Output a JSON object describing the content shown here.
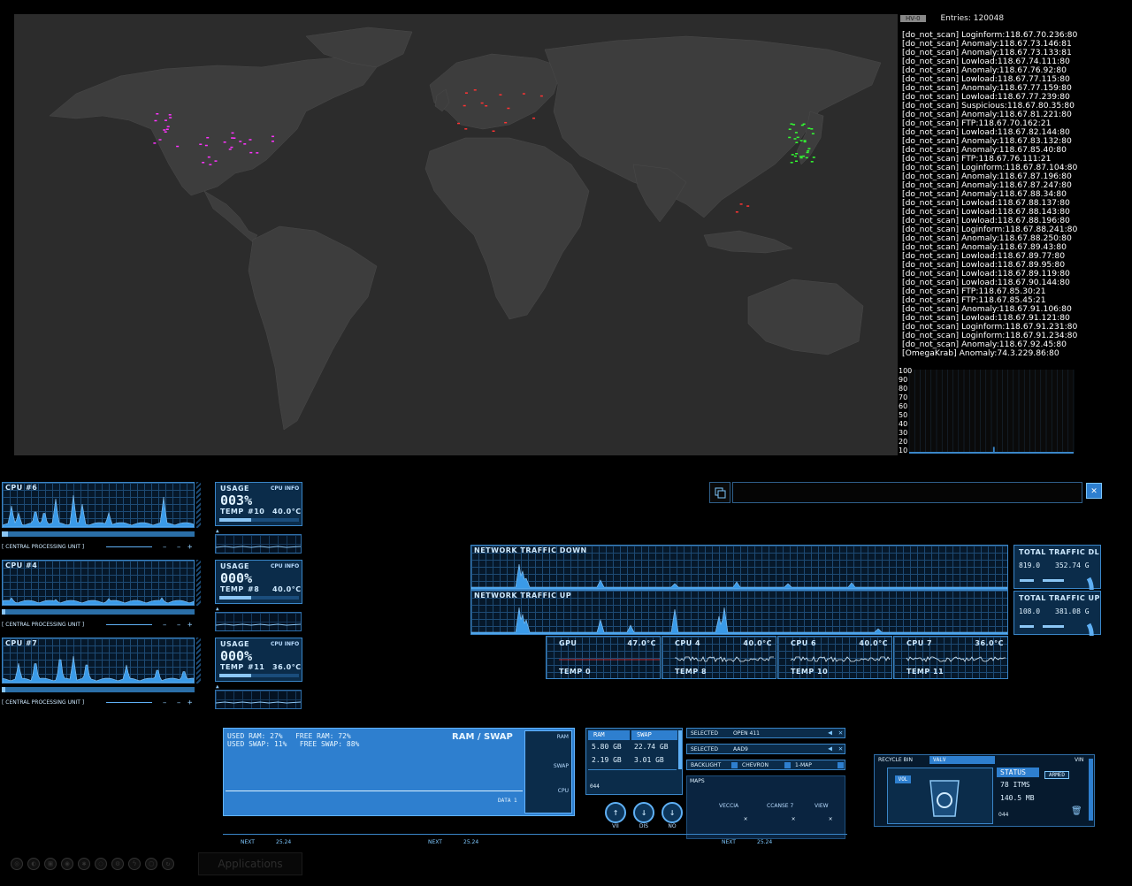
{
  "log": {
    "badge": "HV-0",
    "entries_label": "Entries: 120048",
    "lines": [
      "[do_not_scan] Loginform:118.67.70.236:80",
      "[do_not_scan] Anomaly:118.67.73.146:81",
      "[do_not_scan] Anomaly:118.67.73.133:81",
      "[do_not_scan] Lowload:118.67.74.111:80",
      "[do_not_scan] Anomaly:118.67.76.92:80",
      "[do_not_scan] Lowload:118.67.77.115:80",
      "[do_not_scan] Anomaly:118.67.77.159:80",
      "[do_not_scan] Lowload:118.67.77.239:80",
      "[do_not_scan] Suspicious:118.67.80.35:80",
      "[do_not_scan] Anomaly:118.67.81.221:80",
      "[do_not_scan] FTP:118.67.70.162:21",
      "[do_not_scan] Lowload:118.67.82.144:80",
      "[do_not_scan] Anomaly:118.67.83.132:80",
      "[do_not_scan] Anomaly:118.67.85.40:80",
      "[do_not_scan] FTP:118.67.76.111:21",
      "[do_not_scan] Loginform:118.67.87.104:80",
      "[do_not_scan] Anomaly:118.67.87.196:80",
      "[do_not_scan] Anomaly:118.67.87.247:80",
      "[do_not_scan] Anomaly:118.67.88.34:80",
      "[do_not_scan] Lowload:118.67.88.137:80",
      "[do_not_scan] Lowload:118.67.88.143:80",
      "[do_not_scan] Lowload:118.67.88.196:80",
      "[do_not_scan] Loginform:118.67.88.241:80",
      "[do_not_scan] Anomaly:118.67.88.250:80",
      "[do_not_scan] Anomaly:118.67.89.43:80",
      "[do_not_scan] Lowload:118.67.89.77:80",
      "[do_not_scan] Lowload:118.67.89.95:80",
      "[do_not_scan] Lowload:118.67.89.119:80",
      "[do_not_scan] Lowload:118.67.90.144:80",
      "[do_not_scan] FTP:118.67.85.30:21",
      "[do_not_scan] FTP:118.67.85.45:21",
      "[do_not_scan] Anomaly:118.67.91.106:80",
      "[do_not_scan] Lowload:118.67.91.121:80",
      "[do_not_scan] Loginform:118.67.91.231:80",
      "[do_not_scan] Loginform:118.67.91.234:80",
      "[do_not_scan] Anomaly:118.67.92.45:80",
      "[OmegaKrab] Anomaly:74.3.229.86:80"
    ]
  },
  "histogram": {
    "ticks": [
      "100",
      "90",
      "80",
      "70",
      "60",
      "50",
      "40",
      "30",
      "20",
      "10"
    ],
    "values": [
      0,
      0,
      0,
      0,
      0,
      0,
      0,
      0,
      0,
      0,
      0,
      0,
      0,
      0,
      0,
      0,
      0,
      0,
      0,
      0,
      0,
      0,
      0,
      0,
      0,
      0,
      0,
      0,
      0,
      0,
      0,
      0,
      0,
      0,
      0,
      0,
      0,
      0,
      0,
      0,
      0,
      0,
      0,
      0,
      0,
      0,
      0,
      0,
      0,
      0,
      0,
      7,
      0,
      0,
      0,
      0,
      0,
      0,
      0,
      0,
      0,
      0,
      0,
      0,
      0,
      0,
      0,
      0,
      0,
      0,
      0,
      0,
      0,
      0,
      0,
      0,
      0,
      0,
      0,
      0,
      0,
      0,
      0,
      0,
      0,
      0,
      0,
      0,
      0,
      0,
      0,
      0,
      0,
      0,
      0,
      0,
      0,
      0,
      0,
      0
    ]
  },
  "cpus": [
    {
      "title": "CPU #6",
      "footer": "[ CENTRAL PROCESSING UNIT ]",
      "usage_label": "USAGE",
      "info_label": "CPU INFO",
      "usage": "003%",
      "temp_label": "TEMP",
      "core": "#10",
      "temp": "40.0°C",
      "load": 0.03
    },
    {
      "title": "CPU #4",
      "footer": "[ CENTRAL PROCESSING UNIT ]",
      "usage_label": "USAGE",
      "info_label": "CPU INFO",
      "usage": "000%",
      "temp_label": "TEMP",
      "core": "#8",
      "temp": "40.0°C",
      "load": 0.0
    },
    {
      "title": "CPU #7",
      "footer": "[ CENTRAL PROCESSING UNIT ]",
      "usage_label": "USAGE",
      "info_label": "CPU INFO",
      "usage": "000%",
      "temp_label": "TEMP",
      "core": "#11",
      "temp": "36.0°C",
      "load": 0.0
    }
  ],
  "network": {
    "down_title": "NETWORK TRAFFIC DOWN",
    "up_title": "NETWORK TRAFFIC UP",
    "total_dl": {
      "title": "TOTAL TRAFFIC DL",
      "rate": "819.0",
      "total": "352.74 G"
    },
    "total_up": {
      "title": "TOTAL TRAFFIC UP",
      "rate": "108.0",
      "total": "381.08 G"
    }
  },
  "temps": [
    {
      "name": "GPU",
      "value": "47.0°C",
      "label": "TEMP 0"
    },
    {
      "name": "CPU 4",
      "value": "40.0°C",
      "label": "TEMP 8"
    },
    {
      "name": "CPU 6",
      "value": "40.0°C",
      "label": "TEMP 10"
    },
    {
      "name": "CPU 7",
      "value": "36.0°C",
      "label": "TEMP 11"
    }
  ],
  "ram": {
    "used_ram": "USED RAM: 27%",
    "free_ram": "FREE RAM: 72%",
    "used_swap": "USED SWAP: 11%",
    "free_swap": "FREE SWAP: 88%",
    "title": "RAM / SWAP",
    "data_label": "DATA 1",
    "side_labels": [
      "RAM",
      "SWAP",
      "CPU"
    ]
  },
  "memtable": {
    "headers": [
      "RAM",
      "SWAP"
    ],
    "rows": [
      [
        "5.80 GB",
        "22.74 GB"
      ],
      [
        "2.19 GB",
        "3.01 GB"
      ]
    ],
    "counter": "044",
    "buttons": [
      "VII",
      "DIS",
      "NO"
    ]
  },
  "selectors": {
    "rows": [
      {
        "label": "SELECTED",
        "value": "OPEN 411"
      },
      {
        "label": "SELECTED",
        "value": "AAD9"
      }
    ],
    "options": [
      "BACKLIGHT",
      "CHEVRON",
      "1-MAP"
    ],
    "maps_label": "MAPS",
    "map_items": [
      "VECCIA",
      "CCANSE 7",
      "VIEW"
    ]
  },
  "recycle": {
    "title": "RECYCLE BIN",
    "tab": "VALV",
    "corner": "VIN",
    "vol": "VOL",
    "status_label": "STATUS",
    "status_value": "ARMED",
    "items": "78 ITMS",
    "size": "140.5 MB",
    "counter": "044"
  },
  "timeline": {
    "labels": [
      "NEXT",
      "25.24",
      "NEXT",
      "25.24",
      "NEXT",
      "25.24"
    ]
  },
  "taskbar": {
    "applications": "Applications",
    "icons": [
      "power-icon",
      "globe-icon",
      "linkedin-icon",
      "circle-icon",
      "share-icon",
      "eye-icon",
      "gear-icon",
      "bolt-icon",
      "box-icon",
      "refresh-icon"
    ]
  },
  "colors": {
    "accent": "#3a86c8",
    "panel": "#0b2c4a",
    "map_bg": "#2c2c2c",
    "land": "#3b3b3b",
    "magenta_dot": "#ff33ff",
    "green_dot": "#33ff33",
    "red_dot": "#ff3333",
    "log_text": "#ffffff"
  }
}
